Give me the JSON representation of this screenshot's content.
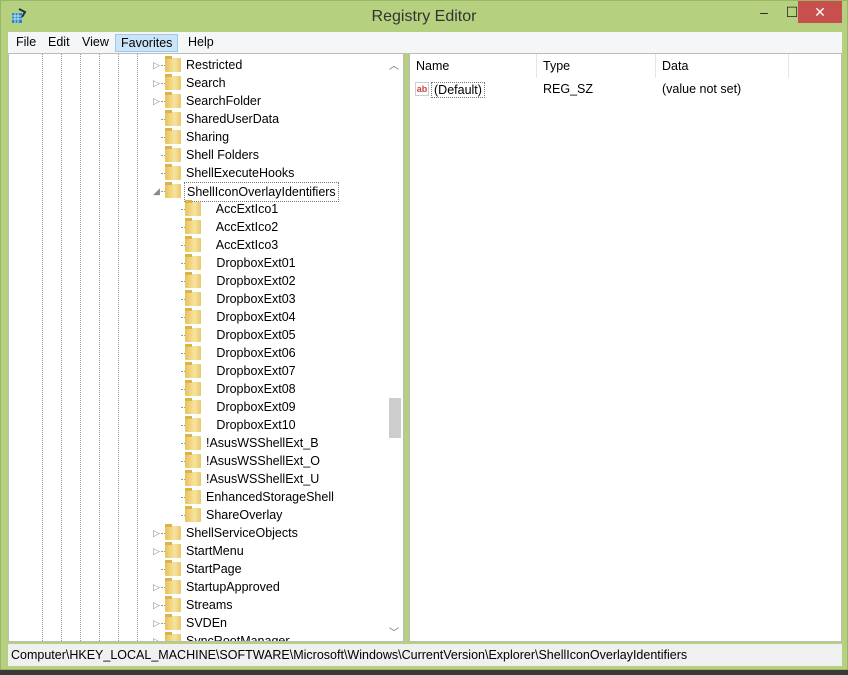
{
  "window": {
    "title": "Registry Editor",
    "minimize": "–",
    "maximize": "☐",
    "close": "✕"
  },
  "menu": [
    "File",
    "Edit",
    "View",
    "Favorites",
    "Help"
  ],
  "menu_selected": "Favorites",
  "tree": [
    {
      "name": "Restricted",
      "level": 0,
      "expander": "collapsed"
    },
    {
      "name": "Search",
      "level": 0,
      "expander": "collapsed"
    },
    {
      "name": "SearchFolder",
      "level": 0,
      "expander": "collapsed"
    },
    {
      "name": "SharedUserData",
      "level": 0,
      "expander": "none"
    },
    {
      "name": "Sharing",
      "level": 0,
      "expander": "none"
    },
    {
      "name": "Shell Folders",
      "level": 0,
      "expander": "none"
    },
    {
      "name": "ShellExecuteHooks",
      "level": 0,
      "expander": "none"
    },
    {
      "name": "ShellIconOverlayIdentifiers",
      "level": 0,
      "expander": "expanded",
      "selected": true
    },
    {
      "name": "   AccExtIco1",
      "level": 1,
      "expander": "none"
    },
    {
      "name": "   AccExtIco2",
      "level": 1,
      "expander": "none"
    },
    {
      "name": "   AccExtIco3",
      "level": 1,
      "expander": "none"
    },
    {
      "name": "   DropboxExt01",
      "level": 1,
      "expander": "none"
    },
    {
      "name": "   DropboxExt02",
      "level": 1,
      "expander": "none"
    },
    {
      "name": "   DropboxExt03",
      "level": 1,
      "expander": "none"
    },
    {
      "name": "   DropboxExt04",
      "level": 1,
      "expander": "none"
    },
    {
      "name": "   DropboxExt05",
      "level": 1,
      "expander": "none"
    },
    {
      "name": "   DropboxExt06",
      "level": 1,
      "expander": "none"
    },
    {
      "name": "   DropboxExt07",
      "level": 1,
      "expander": "none"
    },
    {
      "name": "   DropboxExt08",
      "level": 1,
      "expander": "none"
    },
    {
      "name": "   DropboxExt09",
      "level": 1,
      "expander": "none"
    },
    {
      "name": "   DropboxExt10",
      "level": 1,
      "expander": "none"
    },
    {
      "name": "!AsusWSShellExt_B",
      "level": 1,
      "expander": "none"
    },
    {
      "name": "!AsusWSShellExt_O",
      "level": 1,
      "expander": "none"
    },
    {
      "name": "!AsusWSShellExt_U",
      "level": 1,
      "expander": "none"
    },
    {
      "name": "EnhancedStorageShell",
      "level": 1,
      "expander": "none"
    },
    {
      "name": "ShareOverlay",
      "level": 1,
      "expander": "none"
    },
    {
      "name": "ShellServiceObjects",
      "level": 0,
      "expander": "collapsed"
    },
    {
      "name": "StartMenu",
      "level": 0,
      "expander": "collapsed"
    },
    {
      "name": "StartPage",
      "level": 0,
      "expander": "none"
    },
    {
      "name": "StartupApproved",
      "level": 0,
      "expander": "collapsed"
    },
    {
      "name": "Streams",
      "level": 0,
      "expander": "collapsed"
    },
    {
      "name": "SVDEn",
      "level": 0,
      "expander": "collapsed"
    },
    {
      "name": "SyncRootManager",
      "level": 0,
      "expander": "collapsed"
    }
  ],
  "list": {
    "columns": [
      "Name",
      "Type",
      "Data"
    ],
    "rows": [
      {
        "icon": "string-value-icon",
        "icon_text": "ab",
        "name": "(Default)",
        "type": "REG_SZ",
        "data": "(value not set)"
      }
    ]
  },
  "status": "Computer\\HKEY_LOCAL_MACHINE\\SOFTWARE\\Microsoft\\Windows\\CurrentVersion\\Explorer\\ShellIconOverlayIdentifiers",
  "colors": {
    "titlebar": "#b5d07e",
    "close": "#c7504e",
    "folder": "#e8c25a"
  }
}
